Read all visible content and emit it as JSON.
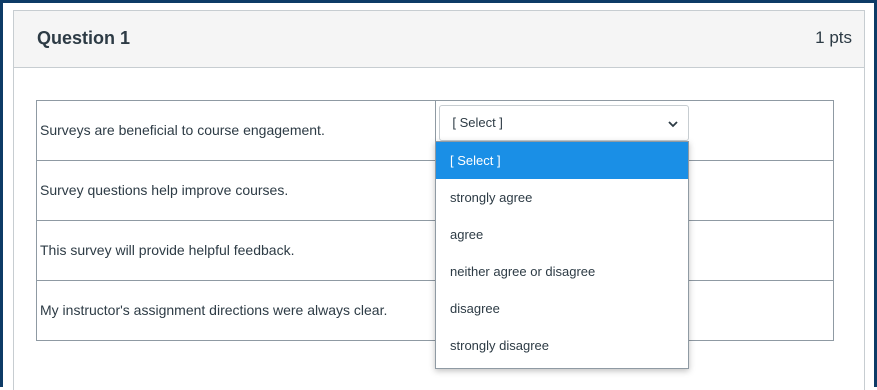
{
  "question": {
    "title": "Question 1",
    "points": "1 pts"
  },
  "rows": [
    {
      "statement": "Surveys are beneficial to course engagement.",
      "selected": "[ Select ]"
    },
    {
      "statement": "Survey questions help improve courses.",
      "selected": ""
    },
    {
      "statement": "This survey will provide helpful feedback.",
      "selected": ""
    },
    {
      "statement": "My instructor's assignment directions were always clear.",
      "selected": ""
    }
  ],
  "dropdown": {
    "options": [
      "[ Select ]",
      "strongly agree",
      "agree",
      "neither agree or disagree",
      "disagree",
      "strongly disagree"
    ],
    "highlighted_index": 0
  },
  "colors": {
    "frame_border": "#0d3b66",
    "header_background": "#f5f5f5",
    "highlight": "#1a8fe6",
    "text": "#2d3b45"
  },
  "icons": {
    "select_chevron": "chevron-down-icon"
  }
}
